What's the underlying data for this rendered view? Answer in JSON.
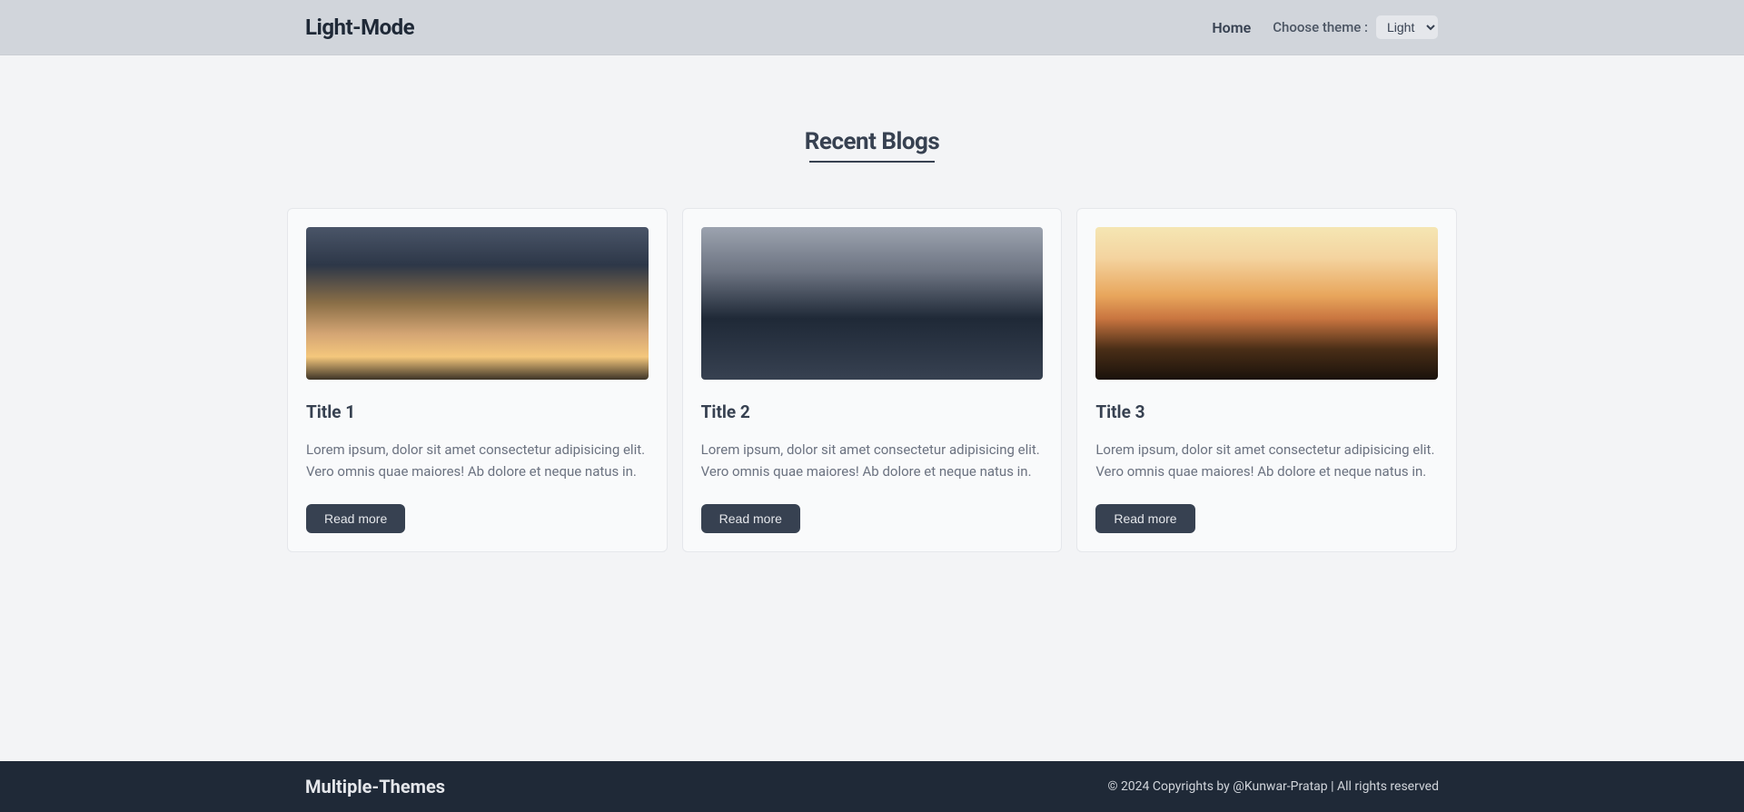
{
  "header": {
    "brand": "Light-Mode",
    "nav_home": "Home",
    "theme_label": "Choose theme :",
    "theme_selected": "Light"
  },
  "main": {
    "section_title": "Recent Blogs",
    "cards": [
      {
        "title": "Title 1",
        "description": "Lorem ipsum, dolor sit amet consectetur adipisicing elit. Vero omnis quae maiores! Ab dolore et neque natus in.",
        "button": "Read more"
      },
      {
        "title": "Title 2",
        "description": "Lorem ipsum, dolor sit amet consectetur adipisicing elit. Vero omnis quae maiores! Ab dolore et neque natus in.",
        "button": "Read more"
      },
      {
        "title": "Title 3",
        "description": "Lorem ipsum, dolor sit amet consectetur adipisicing elit. Vero omnis quae maiores! Ab dolore et neque natus in.",
        "button": "Read more"
      }
    ]
  },
  "footer": {
    "brand": "Multiple-Themes",
    "copyright": "© 2024  Copyrights by @Kunwar-Pratap | All rights reserved"
  }
}
